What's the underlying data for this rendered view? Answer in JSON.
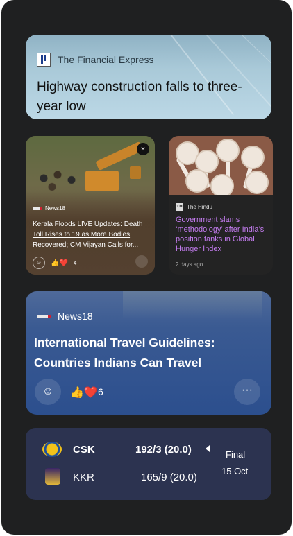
{
  "card_financial_express": {
    "source": "The Financial Express",
    "headline": "Highway construction falls to three-year low"
  },
  "card_kerala": {
    "source": "News18",
    "headline": "Kerala Floods LIVE Updates: Death Toll Rises to 19 as More Bodies Recovered; CM Vijayan Calls for...",
    "close_glyph": "×",
    "reaction_count": "4",
    "more_glyph": "···"
  },
  "card_hindu": {
    "source": "The Hindu",
    "logo_text": "TH",
    "headline": "Government slams ‘methodology’ after India’s position tanks in Global Hunger Index",
    "time": "2 days ago"
  },
  "card_travel": {
    "source": "News18",
    "headline": "International Travel Guidelines: Countries Indians Can Travel",
    "reaction_count": "6",
    "more_glyph": "···"
  },
  "card_cricket": {
    "team1": {
      "name": "CSK",
      "score": "192/3 (20.0)"
    },
    "team2": {
      "name": "KKR",
      "score": "165/9 (20.0)"
    },
    "status": "Final",
    "date": "15 Oct"
  },
  "icons": {
    "reaction_emoji": "👍❤️",
    "add_reaction": "☺"
  }
}
